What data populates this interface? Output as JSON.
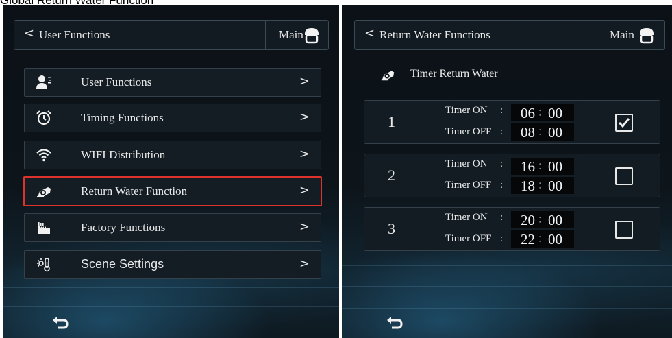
{
  "caption": "Global Return Water Function",
  "left": {
    "header": {
      "back": "<",
      "title": "User Functions",
      "main": "Main"
    },
    "menu": [
      {
        "label": "User Functions",
        "icon": "user-list-icon"
      },
      {
        "label": "Timing Functions",
        "icon": "alarm-clock-icon"
      },
      {
        "label": "WIFI Distribution",
        "icon": "wifi-icon"
      },
      {
        "label": "Return Water Function",
        "icon": "water-pump-icon",
        "selected": true
      },
      {
        "label": "Factory Functions",
        "icon": "factory-icon"
      },
      {
        "label": "Scene Settings",
        "icon": "thermometer-sun-icon"
      }
    ],
    "arrow": ">",
    "selected_border_color": "#e0322c"
  },
  "right": {
    "header": {
      "back": "<",
      "title": "Return Water Functions",
      "main": "Main"
    },
    "section_title": "Timer Return Water",
    "on_label": "Timer ON",
    "off_label": "Timer OFF",
    "colon": ":",
    "timers": [
      {
        "num": "1",
        "on_h": "06",
        "on_m": "00",
        "off_h": "08",
        "off_m": "00",
        "checked": true
      },
      {
        "num": "2",
        "on_h": "16",
        "on_m": "00",
        "off_h": "18",
        "off_m": "00",
        "checked": false
      },
      {
        "num": "3",
        "on_h": "20",
        "on_m": "00",
        "off_h": "22",
        "off_m": "00",
        "checked": false
      }
    ]
  }
}
